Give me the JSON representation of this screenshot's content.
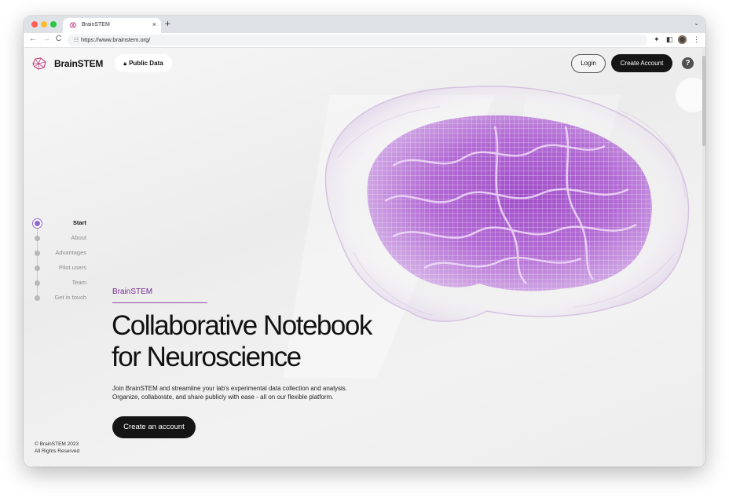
{
  "browser": {
    "tab_title": "BrainSTEM",
    "tab_close": "×",
    "new_tab": "+",
    "tab_menu": "⌄",
    "url": "https://www.brainstem.org/",
    "back": "←",
    "forward": "→",
    "reload": "C"
  },
  "header": {
    "brand": "BrainSTEM",
    "public_data_label": "Public Data",
    "login_label": "Login",
    "create_account_label": "Create Account",
    "help_label": "?"
  },
  "sidenav": {
    "items": [
      {
        "label": "Start",
        "active": true
      },
      {
        "label": "About"
      },
      {
        "label": "Advantages"
      },
      {
        "label": "Pilot users"
      },
      {
        "label": "Team"
      },
      {
        "label": "Get in touch"
      }
    ]
  },
  "hero": {
    "eyebrow": "BrainSTEM",
    "headline_line1": "Collaborative Notebook",
    "headline_line2": "for Neuroscience",
    "subtext_line1": "Join BrainSTEM and streamline your lab's experimental data collection and analysis.",
    "subtext_line2": "Organize, collaborate, and share publicly with ease - all on our flexible platform.",
    "cta_label": "Create an account"
  },
  "footer": {
    "copyright": "© BrainSTEM 2023",
    "rights": "All Rights Reserved"
  },
  "colors": {
    "accent": "#8f6bd1",
    "brand_purple": "#7a2a93",
    "dark_button": "#151515"
  }
}
